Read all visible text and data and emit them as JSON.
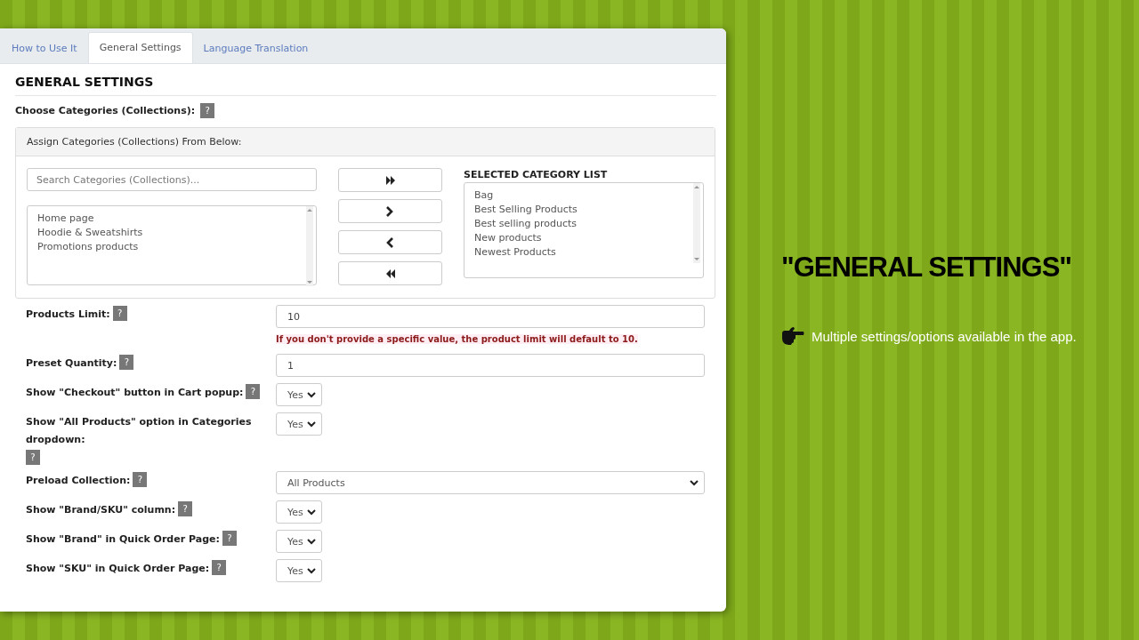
{
  "tabs": [
    {
      "label": "How to Use It",
      "selected": false
    },
    {
      "label": "General Settings",
      "selected": true
    },
    {
      "label": "Language Translation",
      "selected": false
    }
  ],
  "heading": "GENERAL SETTINGS",
  "categories": {
    "label": "Choose Categories (Collections):",
    "help": "?",
    "panel_title": "Assign Categories (Collections) From Below:",
    "search": {
      "placeholder": "Search Categories (Collections)..."
    },
    "available": [
      "Home page",
      "Hoodie & Sweatshirts",
      "Promotions products"
    ],
    "selected_title": "SELECTED CATEGORY LIST",
    "selected_items": [
      "Bag",
      "Best Selling Products",
      "Best selling products",
      "New products",
      "Newest Products"
    ]
  },
  "settings": [
    {
      "kind": "text",
      "label": "Products Limit:",
      "help": "?",
      "value": "10",
      "note": "If you don't provide a specific value, the product limit will default to 10."
    },
    {
      "kind": "text",
      "label": "Preset Quantity:",
      "help": "?",
      "value": "1"
    },
    {
      "kind": "select",
      "label": "Show \"Checkout\" button in Cart popup:",
      "help": "?",
      "value": "Yes"
    },
    {
      "kind": "select",
      "label": "Show \"All Products\" option in Categories dropdown:",
      "help": "?",
      "value": "Yes",
      "help_below": true
    },
    {
      "kind": "wide-select",
      "label": "Preload Collection:",
      "help": "?",
      "value": "All Products"
    },
    {
      "kind": "select",
      "label": "Show \"Brand/SKU\" column:",
      "help": "?",
      "value": "Yes"
    },
    {
      "kind": "select",
      "label": "Show \"Brand\" in Quick Order Page:",
      "help": "?",
      "value": "Yes"
    },
    {
      "kind": "select",
      "label": "Show \"SKU\" in Quick Order Page:",
      "help": "?",
      "value": "Yes"
    }
  ],
  "promo": {
    "title": "\"GENERAL SETTINGS\"",
    "bullet": "Multiple settings/options available in the app."
  }
}
